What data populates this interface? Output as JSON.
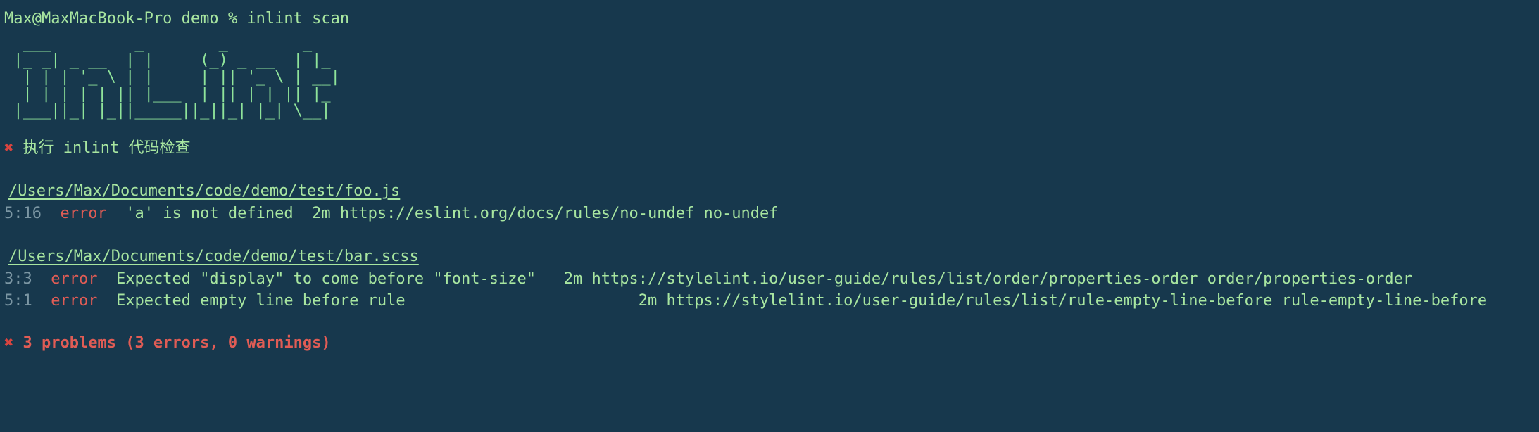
{
  "terminal": {
    "background_color": "#17384d",
    "green": "#a8e6a0",
    "red": "#e05c55",
    "gray": "#7b96a3",
    "prompt": "Max@MaxMacBook-Pro demo % inlint scan",
    "banner": "  ___         _        _        _\n |_ _| _ __  | |     (_) _ __  | |_\n  | | | '_ \\ | |     | || '_ \\ | __|\n  | | | | | || |___  | || | | || |_\n |___||_| |_||_____||_||_| |_| \\__|",
    "task": {
      "mark": "✖",
      "text": "执行 inlint 代码检查"
    },
    "files": [
      {
        "path": "/Users/Max/Documents/code/demo/test/foo.js",
        "issues": [
          {
            "location": "5:16",
            "severity": "error",
            "message": "'a' is not defined",
            "link_prefix": "2m",
            "url": "https://eslint.org/docs/rules/no-undef",
            "rule": "no-undef"
          }
        ]
      },
      {
        "path": "/Users/Max/Documents/code/demo/test/bar.scss",
        "issues": [
          {
            "location": "3:3",
            "severity": "error",
            "message": "Expected \"display\" to come before \"font-size\"",
            "link_prefix": "2m",
            "url": "https://stylelint.io/user-guide/rules/list/order/properties-order",
            "rule": "order/properties-order"
          },
          {
            "location": "5:1",
            "severity": "error",
            "message": "Expected empty line before rule",
            "link_prefix": "2m",
            "url": "https://stylelint.io/user-guide/rules/list/rule-empty-line-before",
            "rule": "rule-empty-line-before"
          }
        ]
      }
    ],
    "summary": {
      "mark": "✖",
      "text": "3 problems (3 errors, 0 warnings)"
    }
  }
}
